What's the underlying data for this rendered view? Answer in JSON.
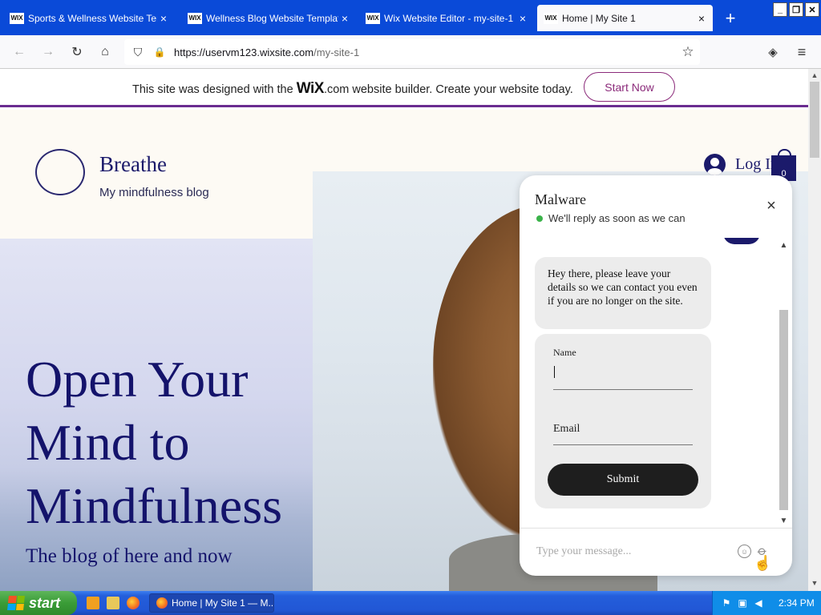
{
  "browser": {
    "tabs": [
      {
        "favicon": "WIX",
        "title": "Sports & Wellness Website Template",
        "close": "×",
        "active": false
      },
      {
        "favicon": "WIX",
        "title": "Wellness Blog Website Template | W",
        "close": "×",
        "active": false
      },
      {
        "favicon": "WIX",
        "title": "Wix Website Editor - my-site-1",
        "close": "×",
        "active": false
      },
      {
        "favicon": "WIX",
        "title": "Home | My Site 1",
        "close": "×",
        "active": true
      }
    ],
    "new_tab": "+",
    "window_controls": {
      "minimize": "_",
      "maximize": "❐",
      "close": "✕"
    },
    "url": {
      "host": "https://uservm123.wixsite.com",
      "path": "/my-site-1"
    },
    "nav_icons": {
      "back": "←",
      "forward": "→",
      "reload": "↻",
      "home": "⌂",
      "shield": "⛉",
      "lock": "🔒",
      "bookmark": "☆",
      "pocket": "◈",
      "menu": "≡"
    }
  },
  "wix_banner": {
    "prefix": "This site was designed with the ",
    "logo": "WiX",
    "suffix": ".com website builder. Create your website today.",
    "button": "Start Now",
    "accent": "#6a2c91"
  },
  "site": {
    "title": "Breathe",
    "subtitle": "My mindfulness blog",
    "login": "Log In",
    "cart_count": "0",
    "hero_heading": [
      "Open Your",
      "Mind to",
      "Mindfulness"
    ],
    "hero_tagline": "The blog of here and now",
    "brand_color": "#14136b"
  },
  "chat": {
    "title": "Malware",
    "status": "We'll reply as soon as we can",
    "close": "×",
    "message": "Hey there, please leave your details so we can contact you even if you are no longer on the site.",
    "form": {
      "name_label": "Name",
      "email_label": "Email",
      "submit": "Submit"
    },
    "input_placeholder": "Type your message...",
    "scroll_up": "▲",
    "scroll_down": "▼"
  },
  "page_scroll": {
    "up": "▲",
    "down": "▼"
  },
  "taskbar": {
    "start": "start",
    "task_item": "Home | My Site 1 — M...",
    "clock": "2:34 PM"
  }
}
